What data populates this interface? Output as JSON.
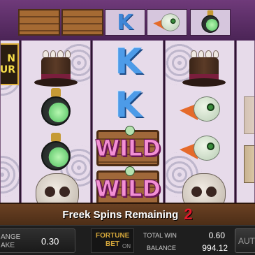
{
  "top_row": {
    "k_symbol": "K"
  },
  "logo": {
    "line1": "N",
    "line2": "UR"
  },
  "reels": {
    "reel3_symbols": [
      "K",
      "K"
    ],
    "wild_label": "WILD"
  },
  "banner": {
    "label": "Freek Spins Remaining",
    "count": "2"
  },
  "controls": {
    "stake_label_line1": "ANGE",
    "stake_label_line2": "AKE",
    "stake_value": "0.30",
    "fortune_bet_line1": "FORTUNE",
    "fortune_bet_line2": "BET",
    "fortune_bet_state": "ON",
    "total_win_label": "TOTAL WIN",
    "total_win_value": "0.60",
    "balance_label": "BALANCE",
    "balance_value": "994.12",
    "auto_label": "AUTO"
  },
  "colors": {
    "k_blue": "#4d9be8",
    "wild_pink": "#f28fd4",
    "count_red": "#e3182a",
    "fortune_gold": "#d3a63a"
  }
}
